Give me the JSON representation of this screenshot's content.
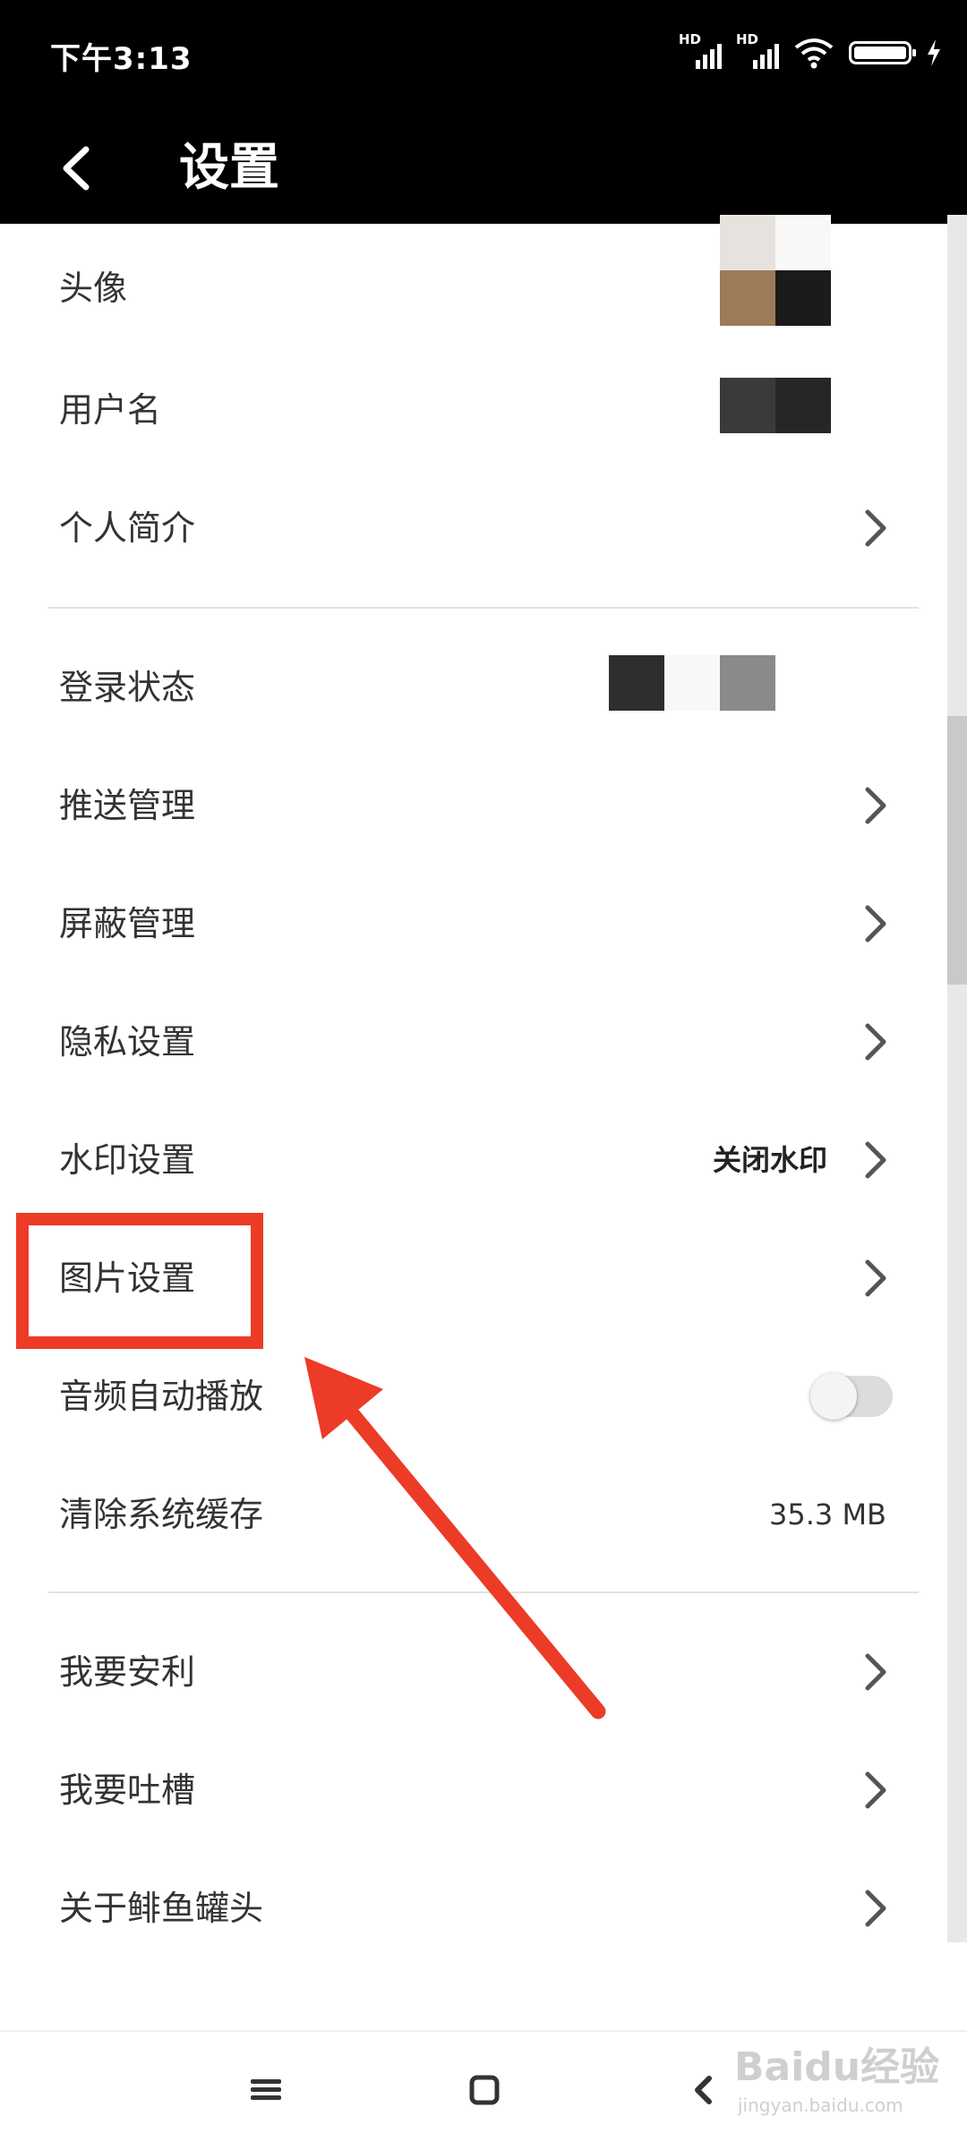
{
  "status_bar": {
    "time": "下午3:13",
    "signal_1_label": "HD",
    "signal_2_label": "HD",
    "battery_text": ""
  },
  "header": {
    "title": "设置",
    "back_icon": "chevron-left-icon"
  },
  "settings": {
    "avatar_label": "头像",
    "username_label": "用户名",
    "bio_label": "个人简介",
    "login_status_label": "登录状态",
    "push_label": "推送管理",
    "block_label": "屏蔽管理",
    "privacy_label": "隐私设置",
    "watermark_label": "水印设置",
    "watermark_value": "关闭水印",
    "image_label": "图片设置",
    "audio_label": "音频自动播放",
    "audio_autoplay": false,
    "cache_label": "清除系统缓存",
    "cache_value": "35.3 MB",
    "recommend_label": "我要安利",
    "feedback_label": "我要吐槽",
    "about_label": "关于鲱鱼罐头"
  },
  "navbar": {
    "menu_icon": "menu-icon",
    "home_icon": "home-square-icon",
    "back_icon": "back-triangle-icon"
  },
  "watermark": {
    "logo_text": "Baidu经验",
    "url_text": "jingyan.baidu.com"
  },
  "annotation": {
    "color": "#ec3b27",
    "highlighted_item": "图片设置"
  }
}
